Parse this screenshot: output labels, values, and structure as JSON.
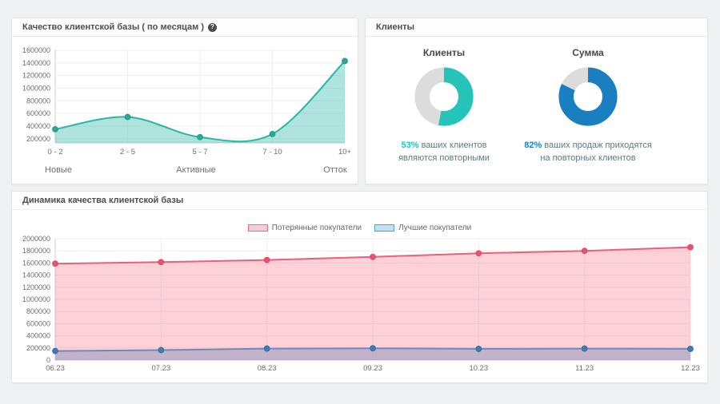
{
  "panels": {
    "quality": {
      "title": "Качество клиентской базы ( по месяцам )",
      "help_glyph": "?"
    },
    "clients": {
      "title": "Клиенты"
    },
    "dynamics": {
      "title": "Динамика качества клиентской базы"
    }
  },
  "chart_data": [
    {
      "type": "area",
      "title": "Качество клиентской базы ( по месяцам )",
      "categories": [
        "0 - 2",
        "2 - 5",
        "5 - 7",
        "7 - 10",
        "10+"
      ],
      "values": [
        350000,
        545000,
        225000,
        275000,
        1430000
      ],
      "yticks": [
        200000,
        400000,
        600000,
        800000,
        1000000,
        1200000,
        1400000,
        1600000
      ],
      "ylim": [
        134000,
        1600000
      ],
      "smooth": true,
      "grid": true,
      "legend_position": "none",
      "line_color": "#2cb5a7",
      "fill_color": "rgba(44,181,167,0.38)",
      "point_color": "#27a99b",
      "group_labels": [
        "Новые",
        "Активные",
        "Отток"
      ]
    },
    {
      "type": "donut",
      "heading": "Клиенты",
      "value": 53,
      "color": "#25c4ba",
      "track_color": "#dcdcdc",
      "caption": {
        "percent": "53%",
        "line1": "ваших клиентов",
        "line2": "являются повторными"
      }
    },
    {
      "type": "donut",
      "heading": "Сумма",
      "value": 82,
      "color": "#1a7fc1",
      "track_color": "#dcdcdc",
      "caption": {
        "percent": "82%",
        "line1": "ваших продаж приходятся",
        "line2": "на повторных клиентов"
      }
    },
    {
      "type": "area",
      "title": "Динамика качества клиентской базы",
      "categories": [
        "06.23",
        "07.23",
        "08.23",
        "09.23",
        "10.23",
        "11.23",
        "12.23"
      ],
      "series": [
        {
          "name": "Потерянные покупатели",
          "values": [
            1590000,
            1615000,
            1650000,
            1700000,
            1760000,
            1800000,
            1860000
          ],
          "line_color": "#ec5f79",
          "fill_color": "rgba(244,103,125,0.30)",
          "point_color": "#e8536f",
          "legend_fill": "#f8ccd4",
          "legend_border": "#ea6880"
        },
        {
          "name": "Лучшие покупатели",
          "values": [
            150000,
            165000,
            190000,
            195000,
            185000,
            190000,
            185000
          ],
          "line_color": "#3b97cf",
          "fill_color": "rgba(59,151,207,0.42)",
          "point_color": "#3f7cb5",
          "legend_fill": "#bfe3f2",
          "legend_border": "#4aa3d6"
        }
      ],
      "yticks": [
        0,
        200000,
        400000,
        600000,
        800000,
        1000000,
        1200000,
        1400000,
        1600000,
        1800000,
        2000000
      ],
      "ylim": [
        0,
        2000000
      ],
      "smooth": false,
      "grid": true,
      "legend_position": "top"
    }
  ]
}
